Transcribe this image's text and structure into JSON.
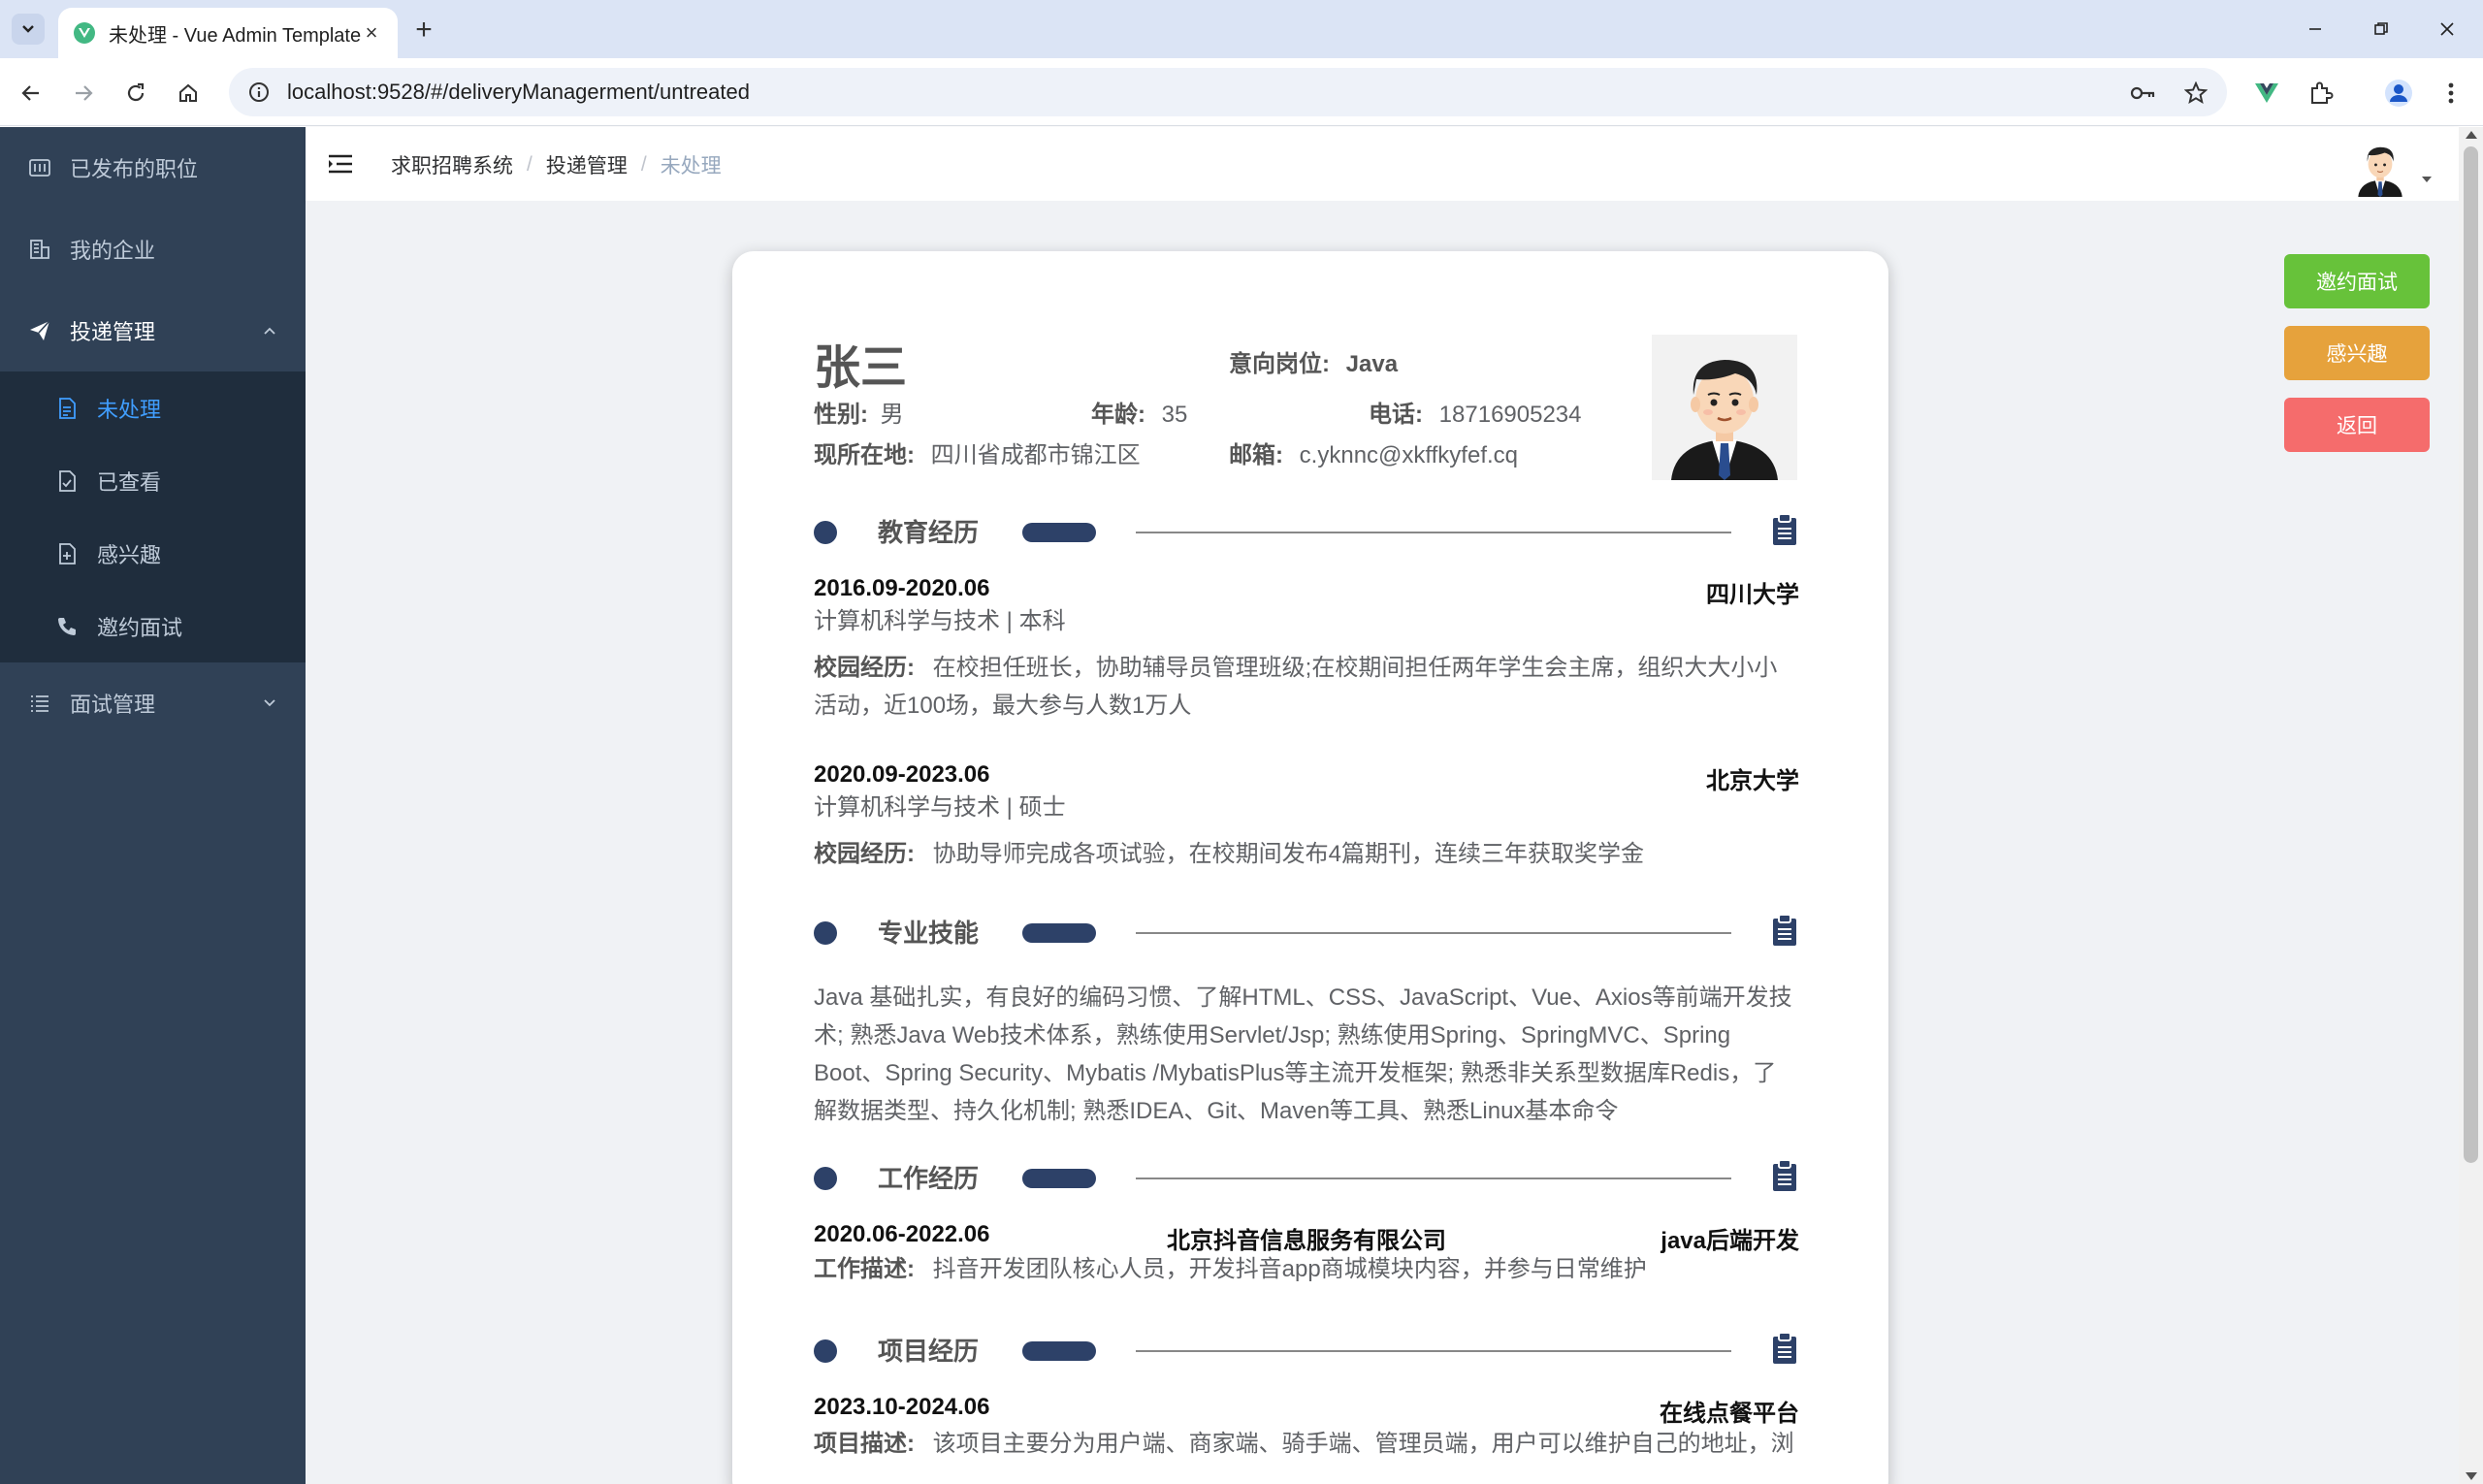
{
  "browser": {
    "tab_title": "未处理 - Vue Admin Template",
    "url": "localhost:9528/#/deliveryManagerment/untreated",
    "colors": {
      "tabbar": "#dbe4f5",
      "vue_green": "#42b883"
    }
  },
  "sidebar": {
    "items": [
      {
        "label": "已发布的职位",
        "icon": "grid-icon"
      },
      {
        "label": "我的企业",
        "icon": "building-icon"
      },
      {
        "label": "投递管理",
        "icon": "paper-plane-icon",
        "expanded": true
      },
      {
        "label": "面试管理",
        "icon": "list-icon",
        "expanded": false
      }
    ],
    "submenu": [
      {
        "label": "未处理",
        "icon": "document-icon",
        "active": true
      },
      {
        "label": "已查看",
        "icon": "document-check-icon",
        "active": false
      },
      {
        "label": "感兴趣",
        "icon": "document-plus-icon",
        "active": false
      },
      {
        "label": "邀约面试",
        "icon": "phone-icon",
        "active": false
      }
    ],
    "colors": {
      "bg": "#304156",
      "sub_bg": "#1f2d3d",
      "text": "#bfcbd9",
      "active": "#409eff"
    }
  },
  "navbar": {
    "breadcrumb": [
      "求职招聘系统",
      "投递管理",
      "未处理"
    ],
    "separator": "/"
  },
  "actions": {
    "invite": "邀约面试",
    "interest": "感兴趣",
    "back": "返回",
    "colors": {
      "invite": "#67c23a",
      "interest": "#e6a23c",
      "back": "#f56c6c"
    }
  },
  "resume": {
    "name": "张三",
    "position_label": "意向岗位:",
    "position": "Java",
    "gender_label": "性别:",
    "gender": "男",
    "age_label": "年龄:",
    "age": "35",
    "phone_label": "电话:",
    "phone": "18716905234",
    "location_label": "现所在地:",
    "location": "四川省成都市锦江区",
    "email_label": "邮箱:",
    "email": "c.yknnc@xkffkyfef.cq",
    "sections": {
      "education": "教育经历",
      "skills": "专业技能",
      "work": "工作经历",
      "project": "项目经历"
    },
    "education": [
      {
        "period": "2016.09-2020.06",
        "school": "四川大学",
        "major": "计算机科学与技术 | 本科",
        "campus_label": "校园经历:",
        "campus": "在校担任班长，协助辅导员管理班级;在校期间担任两年学生会主席，组织大大小小活动，近100场，最大参与人数1万人"
      },
      {
        "period": "2020.09-2023.06",
        "school": "北京大学",
        "major": "计算机科学与技术 | 硕士",
        "campus_label": "校园经历:",
        "campus": "协助导师完成各项试验，在校期间发布4篇期刊，连续三年获取奖学金"
      }
    ],
    "skills_text": "Java 基础扎实，有良好的编码习惯、了解HTML、CSS、JavaScript、Vue、Axios等前端开发技术; 熟悉Java Web技术体系，熟练使用Servlet/Jsp; 熟练使用Spring、SpringMVC、Spring Boot、Spring Security、Mybatis /MybatisPlus等主流开发框架; 熟悉非关系型数据库Redis，了解数据类型、持久化机制; 熟悉IDEA、Git、Maven等工具、熟悉Linux基本命令",
    "work": {
      "period": "2020.06-2022.06",
      "company": "北京抖音信息服务有限公司",
      "role": "java后端开发",
      "desc_label": "工作描述:",
      "desc": "抖音开发团队核心人员，开发抖音app商城模块内容，并参与日常维护"
    },
    "project": {
      "period": "2023.10-2024.06",
      "name": "在线点餐平台",
      "desc_label": "项目描述:",
      "desc": "该项目主要分为用户端、商家端、骑手端、管理员端，用户可以维护自己的地址，浏"
    },
    "colors": {
      "accent": "#2d4168"
    }
  }
}
